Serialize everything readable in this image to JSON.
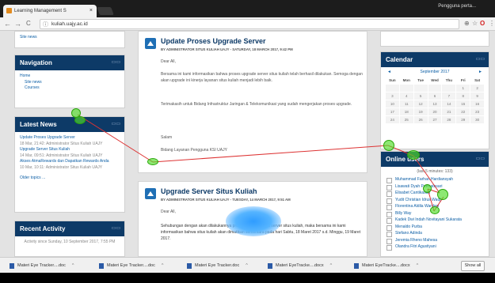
{
  "browser": {
    "tab_title": "Learning Management S",
    "tab_close": "×",
    "user_name": "Pengguna perta...",
    "url": "kuliah.uajy.ac.id",
    "nav_back": "←",
    "nav_forward": "→",
    "nav_reload": "C",
    "info_icon": "ⓘ",
    "icon_names": [
      "back-icon",
      "forward-icon",
      "reload-icon",
      "info-icon",
      "translate-icon",
      "star-icon",
      "opera-icon",
      "menu-icon"
    ],
    "right_icons": [
      "⊕",
      "☆",
      "O",
      "⋮"
    ]
  },
  "left": {
    "site_news_top": "Site news",
    "navigation": {
      "title": "Navigation",
      "items": [
        "Home",
        "Site news",
        "Courses"
      ]
    },
    "latest_news": {
      "title": "Latest News",
      "entries": [
        {
          "title": "Update Proses Upgrade Server",
          "meta": "18 Mar, 21:42: Administrator Situs Kuliah UAJY"
        },
        {
          "title": "Upgrade Server Situs Kuliah",
          "meta": "14 Mar, 09:51: Administrator Situs Kuliah UAJY"
        },
        {
          "title": "Akses AtmaRewards dan Dapatkan Rewards Anda",
          "meta": "10 Mar, 10:11: Administrator Situs Kuliah UAJY"
        }
      ],
      "older": "Older topics ..."
    },
    "recent_activity": {
      "title": "Recent Activity",
      "text": "Activity since Sunday, 10 September 2017, 7:55 PM"
    }
  },
  "posts": [
    {
      "title": "Update Proses Upgrade Server",
      "meta": "BY ADMINISTRATOR SITUS KULIAH UAJY - SATURDAY, 18 MARCH 2017, 9:42 PM",
      "greeting": "Dear All,",
      "body1": "Bersama ini kami informasikan bahwa proses upgrade server situs kuliah telah berhasil dilakukan. Semoga dengan akan upgrade ini kinerja layanan situs kuliah menjadi lebih baik.",
      "body2": "Terimakasih untuk Bidang Infrastruktur Jaringan & Telekomunikasi yang sudah mengerjakan proses upgrade.",
      "closing": "Salam",
      "sign": "Bidang Layanan Pengguna KSI UAJY"
    },
    {
      "title": "Upgrade Server Situs Kuliah",
      "meta": "BY ADMINISTRATOR SITUS KULIAH UAJY - TUESDAY, 14 MARCH 2017, 9:51 AM",
      "greeting": "Dear All,",
      "body1": "Sehubungan dengan akan dilakukannya proses upgrade pada server situs kuliah, maka bersama ini kami informasikan bahwa situs kuliah akan dimatikan sementara pada hari Sabtu, 18 Maret 2017 s.d. Minggu, 19 Maret 2017."
    }
  ],
  "right": {
    "calendar": {
      "title": "Calendar",
      "month": "September 2017",
      "prev": "◄",
      "next": "►",
      "days": [
        "Sun",
        "Mon",
        "Tue",
        "Wed",
        "Thu",
        "Fri",
        "Sat"
      ],
      "cells": [
        "",
        "",
        "",
        "",
        "",
        "1",
        "2",
        "3",
        "4",
        "5",
        "6",
        "7",
        "8",
        "9",
        "10",
        "11",
        "12",
        "13",
        "14",
        "15",
        "16",
        "17",
        "18",
        "19",
        "20",
        "21",
        "22",
        "23",
        "24",
        "25",
        "26",
        "27",
        "28",
        "29",
        "30"
      ]
    },
    "online_users": {
      "title": "Online users",
      "period": "(last 5 minutes: 133)",
      "users": [
        "Muhammad Farhan Hardiansyah",
        "Lisawati Dyah Permatasari",
        "Elisabet Cantikasari",
        "Yudit Christian Idrus Wadji",
        "Florentina Aldila Wardani",
        "Billy Way",
        "Kadek Dwi Indah Novitayani Sukarata",
        "Menaldo Purba",
        "Stefano Adinda",
        "Jeremia Rheno Mahesa",
        "Olandra Fitri Agustiyani"
      ]
    }
  },
  "downloads": {
    "items": [
      "Materi Eye Tracker....doc",
      "Materi Eye Tracker....doc",
      "Materi Eye Tracker.doc",
      "Materi EyeTracke....docx",
      "Materi EyeTracke....docx"
    ],
    "chevron": "^",
    "show_all": "Show all"
  }
}
